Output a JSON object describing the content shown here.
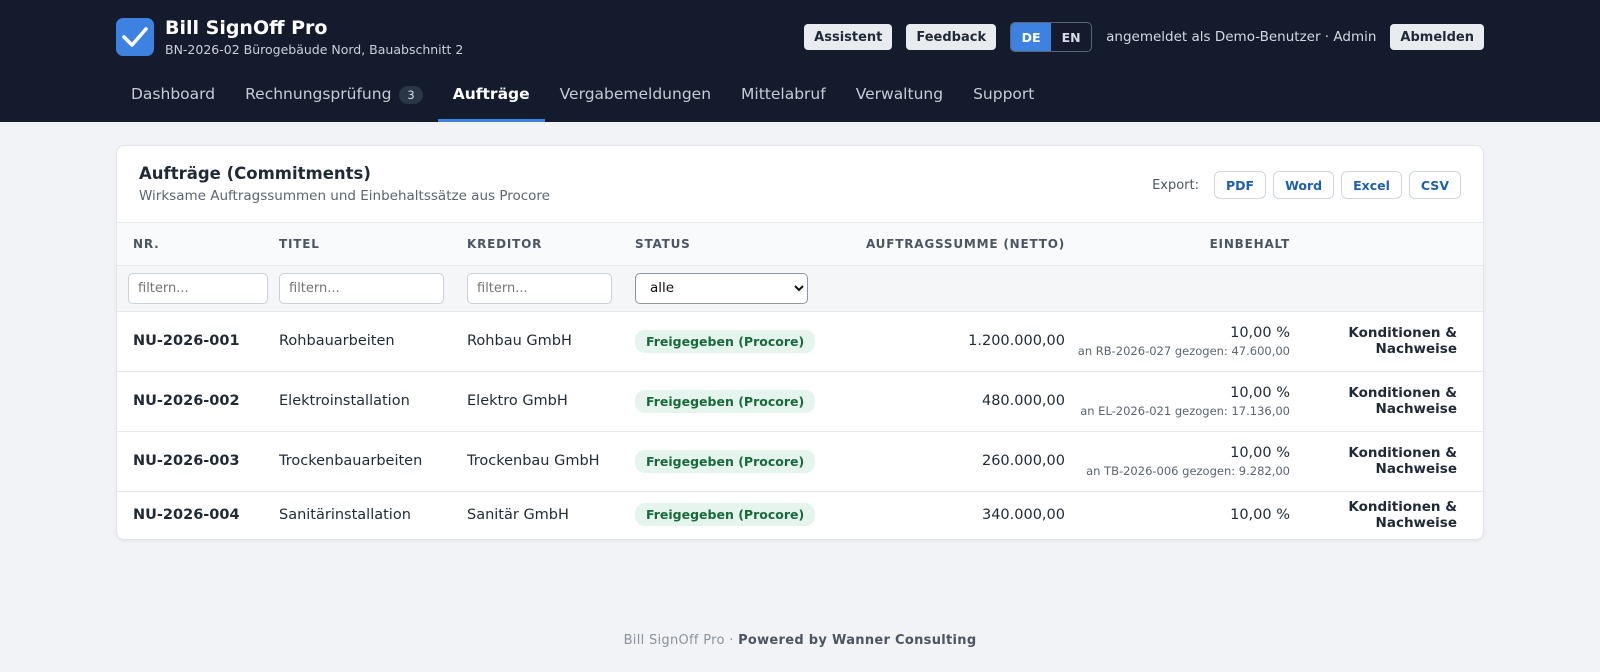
{
  "app": {
    "title": "Bill SignOff Pro",
    "project": "BN-2026-02 Bürogebäude Nord, Bauabschnitt 2"
  },
  "header": {
    "assistant_label": "Assistent",
    "feedback_label": "Feedback",
    "lang_de": "DE",
    "lang_en": "EN",
    "user_text": "angemeldet als Demo-Benutzer · Admin",
    "logout_label": "Abmelden"
  },
  "nav": {
    "dashboard": "Dashboard",
    "rechnungspruefung": "Rechnungsprüfung",
    "rechnungspruefung_count": "3",
    "auftraege": "Aufträge",
    "vergabemeldungen": "Vergabemeldungen",
    "mittelabruf": "Mittelabruf",
    "verwaltung": "Verwaltung",
    "support": "Support"
  },
  "card": {
    "title": "Aufträge (Commitments)",
    "subtitle": "Wirksame Auftragssummen und Einbehaltssätze aus Procore",
    "export_label": "Export:",
    "export_pdf": "PDF",
    "export_word": "Word",
    "export_excel": "Excel",
    "export_csv": "CSV"
  },
  "table": {
    "columns": [
      "NR.",
      "TITEL",
      "KREDITOR",
      "STATUS",
      "AUFTRAGSSUMME (NETTO)",
      "EINBEHALT"
    ],
    "filter_placeholder": "filtern...",
    "status_filter_value": "alle",
    "rows": [
      {
        "nr": "NU-2026-001",
        "titel": "Rohbauarbeiten",
        "kreditor": "Rohbau GmbH",
        "status": "Freigegeben (Procore)",
        "summe": "1.200.000,00",
        "einbehalt": "10,00 %",
        "gezogen": "an RB-2026-027 gezogen: 47.600,00",
        "action": "Konditionen & Nachweise"
      },
      {
        "nr": "NU-2026-002",
        "titel": "Elektroinstallation",
        "kreditor": "Elektro GmbH",
        "status": "Freigegeben (Procore)",
        "summe": "480.000,00",
        "einbehalt": "10,00 %",
        "gezogen": "an EL-2026-021 gezogen: 17.136,00",
        "action": "Konditionen & Nachweise"
      },
      {
        "nr": "NU-2026-003",
        "titel": "Trockenbauarbeiten",
        "kreditor": "Trockenbau GmbH",
        "status": "Freigegeben (Procore)",
        "summe": "260.000,00",
        "einbehalt": "10,00 %",
        "gezogen": "an TB-2026-006 gezogen: 9.282,00",
        "action": "Konditionen & Nachweise"
      },
      {
        "nr": "NU-2026-004",
        "titel": "Sanitärinstallation",
        "kreditor": "Sanitär GmbH",
        "status": "Freigegeben (Procore)",
        "summe": "340.000,00",
        "einbehalt": "10,00 %",
        "gezogen": "",
        "action": "Konditionen & Nachweise"
      }
    ]
  },
  "footer": {
    "brand": "Bill SignOff Pro",
    "separator": "·",
    "powered": "Powered by Wanner Consulting"
  }
}
